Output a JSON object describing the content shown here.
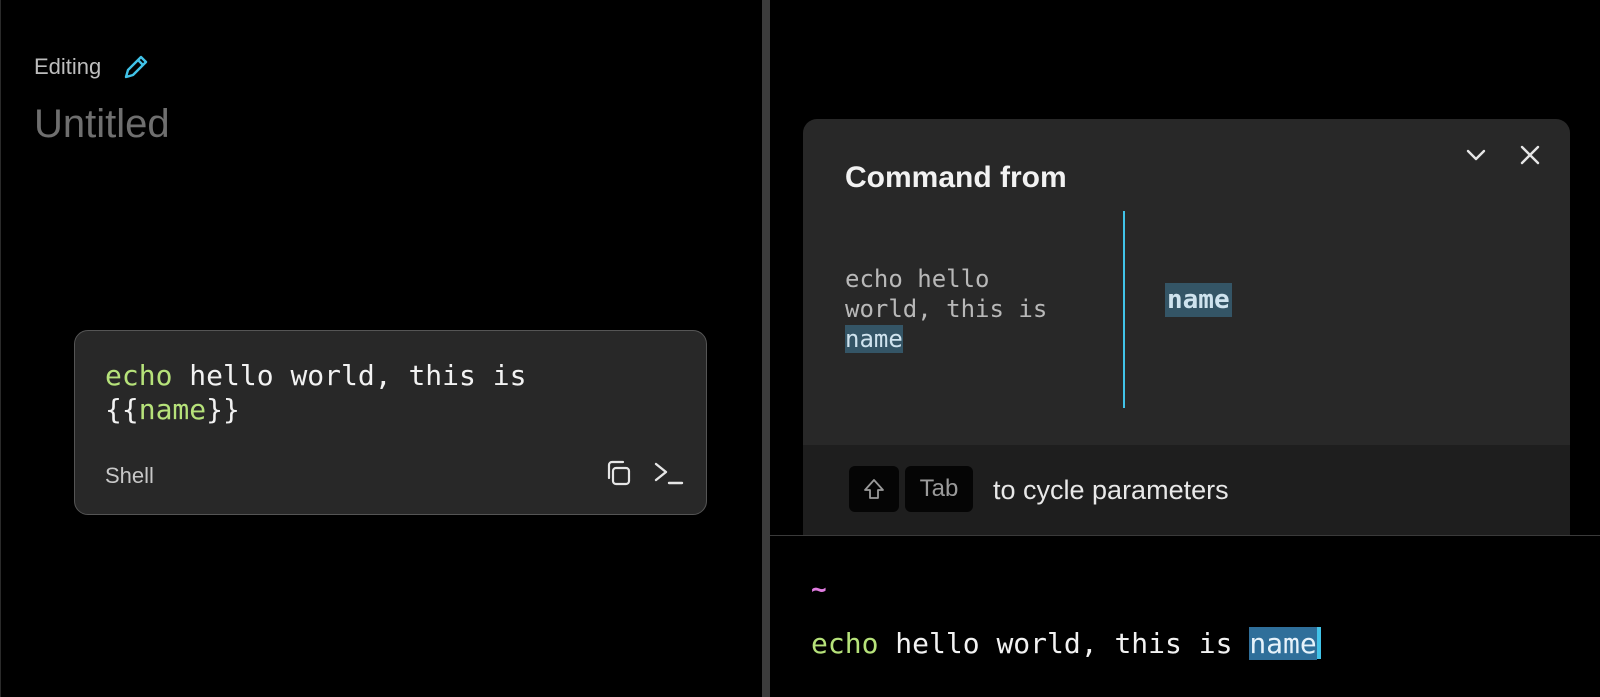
{
  "colors": {
    "background": "#000000",
    "card": "#282828",
    "accent": "#41c3e8",
    "keyword_green": "#b6e27a",
    "param_highlight": "#345566",
    "prompt_pink": "#e07ce0"
  },
  "editor": {
    "editing_label": "Editing",
    "edit_icon": "pencil-icon",
    "title": "Untitled",
    "card": {
      "line1_keyword": "echo",
      "line1_rest": " hello world, this is",
      "line2_open": "{{",
      "line2_param": "name",
      "line2_close": "}}",
      "language": "Shell",
      "copy_icon": "copy-icon",
      "run_icon": "terminal-icon"
    }
  },
  "command_dialog": {
    "title": "Command from",
    "collapse_icon": "chevron-down-icon",
    "close_icon": "close-icon",
    "preview": {
      "line1": "echo hello",
      "line2": "world, this is",
      "param": "name"
    },
    "param_value": "name",
    "hint": {
      "key_shift": "⇧",
      "key_tab": "Tab",
      "text": "to cycle parameters"
    }
  },
  "terminal": {
    "prompt": "~",
    "keyword": "echo",
    "rest": " hello world, this is ",
    "param": "name"
  }
}
